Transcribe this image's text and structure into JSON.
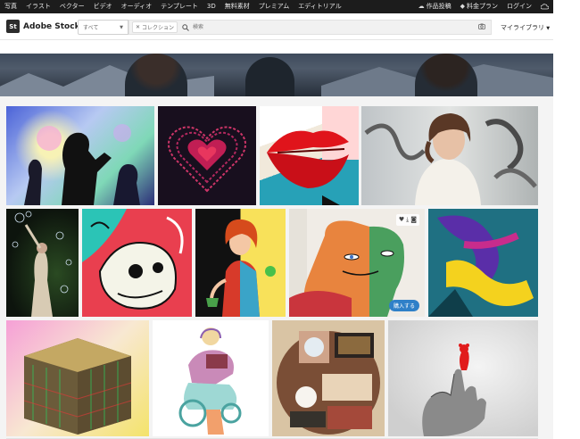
{
  "topnav": {
    "items": [
      "写真",
      "イラスト",
      "ベクター",
      "ビデオ",
      "オーディオ",
      "テンプレート",
      "3D",
      "無料素材",
      "プレミアム",
      "エディトリアル"
    ],
    "submit": "作品投稿",
    "pricing": "料金プラン",
    "login": "ログイン"
  },
  "header": {
    "logo_badge": "St",
    "logo_text": "Adobe Stock",
    "category": "すべて",
    "collection_chip": "コレクション",
    "search_placeholder": "検索",
    "my_library": "マイライブラリ"
  },
  "hover_tile": {
    "buy_label": "購入する"
  },
  "colors": {
    "topnav_bg": "#1c1c1c",
    "buy_button": "#2f80c8"
  }
}
